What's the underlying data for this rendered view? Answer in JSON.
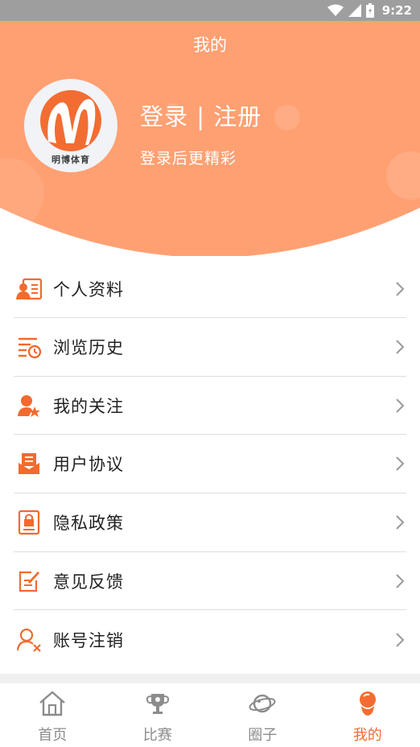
{
  "status_bar": {
    "time": "9:22"
  },
  "header": {
    "title": "我的",
    "avatar_text": "明博体育",
    "login_label": "登录 | 注册",
    "login_subtitle": "登录后更精彩"
  },
  "menu": {
    "items": [
      {
        "label": "个人资料",
        "icon": "profile-card-icon"
      },
      {
        "label": "浏览历史",
        "icon": "history-icon"
      },
      {
        "label": "我的关注",
        "icon": "follow-star-icon"
      },
      {
        "label": "用户协议",
        "icon": "agreement-icon"
      },
      {
        "label": "隐私政策",
        "icon": "privacy-lock-icon"
      },
      {
        "label": "意见反馈",
        "icon": "feedback-edit-icon"
      },
      {
        "label": "账号注销",
        "icon": "account-cancel-icon"
      }
    ]
  },
  "bottom_nav": {
    "items": [
      {
        "label": "首页",
        "icon": "home-icon"
      },
      {
        "label": "比赛",
        "icon": "trophy-icon"
      },
      {
        "label": "圈子",
        "icon": "planet-icon"
      },
      {
        "label": "我的",
        "icon": "user-icon",
        "active": true
      }
    ]
  },
  "colors": {
    "accent": "#f36d32",
    "header_bg": "#ffa072",
    "icon_orange": "#f26a2e"
  }
}
